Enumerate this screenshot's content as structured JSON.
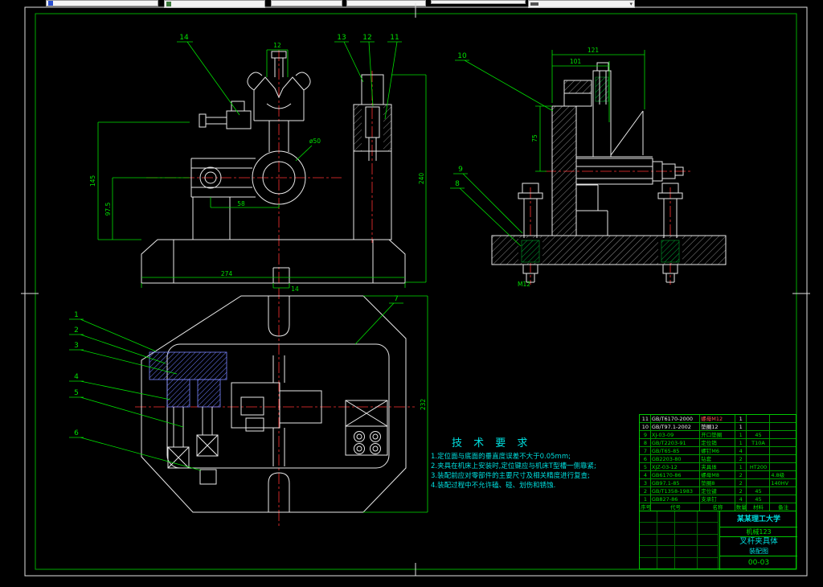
{
  "icons": {
    "dropdown_arrow": "▾"
  },
  "colors": {
    "line": "#e8e8e8",
    "dim": "#00ff00",
    "center": "#ff3333",
    "aux": "#00e5e5",
    "hatch_blue": "#6b7bff",
    "frame": "#00aa00"
  },
  "drawing": {
    "leaders": {
      "front": [
        "14",
        "13",
        "12",
        "11"
      ],
      "side": [
        "10",
        "9",
        "8"
      ],
      "plan": [
        "1",
        "2",
        "3",
        "4",
        "5",
        "6",
        "7"
      ]
    },
    "dims": {
      "front": {
        "height": "145",
        "height2": "97.5",
        "base": "274",
        "slot": "14",
        "arm": "58",
        "boss": "ø50",
        "top": "12",
        "overall": "240"
      },
      "side": {
        "w1": "121",
        "w2": "101",
        "h": "75",
        "bolt": "M12"
      },
      "plan": {
        "h": "232"
      }
    },
    "tech": {
      "title": "技 术 要 求",
      "lines": [
        "1.定位面与底面的垂直度误差不大于0.05mm;",
        "2.夹具在机床上安装时,定位键应与机床T型槽一侧靠紧;",
        "3.装配前应对零部件的主要尺寸及相关精度进行复查;",
        "4.装配过程中不允许磕、碰、划伤和锈蚀."
      ]
    },
    "title_block": {
      "header": {
        "no": "序号",
        "code": "代号",
        "name": "名称",
        "qty": "数量",
        "material": "材料",
        "note": "备注"
      },
      "bom": [
        {
          "no": "11",
          "code": "GB/T6170-2000",
          "name": "螺母M12",
          "qty": "1",
          "material": "",
          "note": "",
          "hl": true,
          "red": true
        },
        {
          "no": "10",
          "code": "GB/T97.1-2002",
          "name": "垫圈12",
          "qty": "1",
          "material": "",
          "note": "",
          "hl": true
        },
        {
          "no": "9",
          "code": "XJ-03-09",
          "name": "开口垫圈",
          "qty": "1",
          "material": "45",
          "note": ""
        },
        {
          "no": "8",
          "code": "GB/T2203-91",
          "name": "定位销",
          "qty": "1",
          "material": "T10A",
          "note": ""
        },
        {
          "no": "7",
          "code": "GB/T65-85",
          "name": "螺钉M6",
          "qty": "4",
          "material": "",
          "note": ""
        },
        {
          "no": "6",
          "code": "GB2203-80",
          "name": "钻套",
          "qty": "2",
          "material": "",
          "note": ""
        },
        {
          "no": "5",
          "code": "XJZ-03-12",
          "name": "夹具体",
          "qty": "1",
          "material": "HT200",
          "note": ""
        },
        {
          "no": "4",
          "code": "GB6170-86",
          "name": "螺母M8",
          "qty": "2",
          "material": "",
          "note": "4.8级"
        },
        {
          "no": "3",
          "code": "GB97.1-85",
          "name": "垫圈8",
          "qty": "2",
          "material": "",
          "note": "140HV"
        },
        {
          "no": "2",
          "code": "GB/T1358-1983",
          "name": "定位键",
          "qty": "2",
          "material": "45",
          "note": ""
        },
        {
          "no": "1",
          "code": "GB827-86",
          "name": "支承钉",
          "qty": "4",
          "material": "45",
          "note": ""
        }
      ],
      "org": "某某理工大学",
      "cls": "机械123",
      "part": "叉杆夹具体",
      "doc": "装配图",
      "number": "00-03"
    }
  }
}
